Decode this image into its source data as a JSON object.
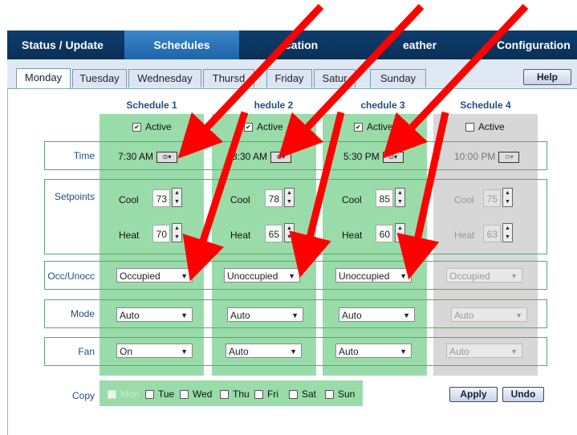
{
  "nav": [
    "Status / Update",
    "Schedules",
    "Vacation",
    "Weather",
    "Configuration"
  ],
  "nav_visible": [
    "Status / Update",
    "Schedules",
    "",
    "cation",
    "eather",
    "Configuration"
  ],
  "tabs": [
    "Monday",
    "Tuesday",
    "Wednesday",
    "Thursday",
    "Friday",
    "Saturday",
    "Sunday"
  ],
  "tab_visible": [
    "Monday",
    "Tuesday",
    "Wednesday",
    "Thursd",
    "Friday",
    "Satur",
    "Sunday"
  ],
  "help": "Help",
  "schedules": [
    {
      "title": "Schedule 1",
      "active_label": "Active",
      "active": true,
      "time": "7:30 AM",
      "cool": "73",
      "heat": "70",
      "occ": "Occupied",
      "mode": "Auto",
      "fan": "On",
      "enabled": true
    },
    {
      "title": "Schedule 2",
      "title_visible": "hedule 2",
      "active_label": "Active",
      "active": true,
      "time": "8:30 AM",
      "cool": "78",
      "heat": "65",
      "occ": "Unoccupied",
      "mode": "Auto",
      "fan": "Auto",
      "enabled": true
    },
    {
      "title": "Schedule 3",
      "title_visible": "chedule 3",
      "active_label": "Active",
      "active": true,
      "time": "5:30 PM",
      "cool": "85",
      "heat": "60",
      "occ": "Unoccupied",
      "mode": "Auto",
      "fan": "Auto",
      "enabled": true
    },
    {
      "title": "Schedule 4",
      "active_label": "Active",
      "active": false,
      "time": "10:00 PM",
      "cool": "75",
      "heat": "63",
      "occ": "Occupied",
      "mode": "Auto",
      "fan": "Auto",
      "enabled": false
    }
  ],
  "row_labels": {
    "time": "Time",
    "setpoints": "Setpoints",
    "occ": "Occ/Unocc",
    "mode": "Mode",
    "fan": "Fan",
    "copy": "Copy"
  },
  "setpoint_labels": {
    "cool": "Cool",
    "heat": "Heat"
  },
  "copy_days": [
    "Mon",
    "Tue",
    "Wed",
    "Thu",
    "Fri",
    "Sat",
    "Sun"
  ],
  "buttons": {
    "apply": "Apply",
    "undo": "Undo"
  },
  "colors": {
    "nav": "#0a2f57",
    "active_nav": "#2f78bd",
    "schedule_bg": "#99dcaa",
    "disabled_bg": "#d7d7d7",
    "arrow": "#ff0000"
  }
}
